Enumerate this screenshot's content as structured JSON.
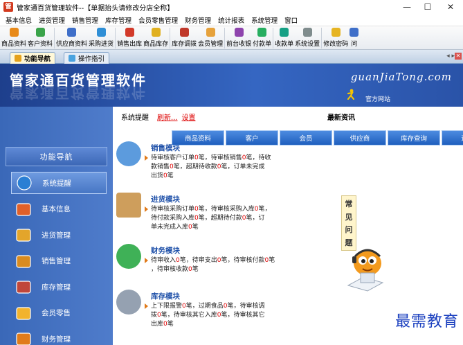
{
  "window": {
    "app_icon_char": "管",
    "title": "管家通百货管理软件--【单据抬头请修改分店全称】",
    "min_glyph": "—",
    "max_glyph": "☐",
    "close_glyph": "✕"
  },
  "menu": [
    "基本信息",
    "进货管理",
    "销售管理",
    "库存管理",
    "会员零售管理",
    "财务管理",
    "统计报表",
    "系统管理",
    "窗口"
  ],
  "toolbar": [
    {
      "label": "商品资料",
      "icon": "goods-icon",
      "color": "#e88a1a"
    },
    {
      "label": "客户资料",
      "icon": "customer-icon",
      "color": "#3aa34a"
    },
    {
      "label": "供应商资料",
      "icon": "supplier-icon",
      "color": "#3f6fc9"
    },
    {
      "label": "采购进货",
      "icon": "purchase-icon",
      "color": "#2f8fd6"
    },
    {
      "label": "销售出库",
      "icon": "sales-out-icon",
      "color": "#d23a2a"
    },
    {
      "label": "商品库存",
      "icon": "stock-icon",
      "color": "#e0b020"
    },
    {
      "label": "库存调拨",
      "icon": "transfer-icon",
      "color": "#c0392b"
    },
    {
      "label": "会员管理",
      "icon": "member-icon",
      "color": "#e6a23c"
    },
    {
      "label": "前台收银",
      "icon": "cashier-icon",
      "color": "#8e44ad"
    },
    {
      "label": "付款单",
      "icon": "payment-icon",
      "color": "#27ae60"
    },
    {
      "label": "收款单",
      "icon": "receipt-icon",
      "color": "#16a085"
    },
    {
      "label": "系统设置",
      "icon": "settings-icon",
      "color": "#7f8c8d"
    },
    {
      "label": "修改密码",
      "icon": "password-icon",
      "color": "#e6b422"
    },
    {
      "label": "问",
      "icon": "help-icon",
      "color": "#3f6fc9"
    }
  ],
  "tabs": [
    {
      "label": "功能导航"
    },
    {
      "label": "操作指引"
    }
  ],
  "tabnav": "◂ ▸",
  "tabclose": "✕",
  "banner": {
    "app_name": "管家通百货管理软件",
    "site": "guanJiaTong.com",
    "site_link": "官方网站"
  },
  "sidebar": {
    "header": "功能导航",
    "items": [
      {
        "label": "系统提醒",
        "icon": "info-icon",
        "active": true
      },
      {
        "label": "基本信息",
        "icon": "cubes-icon"
      },
      {
        "label": "进货管理",
        "icon": "purchase-box-icon"
      },
      {
        "label": "销售管理",
        "icon": "sales-box-icon"
      },
      {
        "label": "库存管理",
        "icon": "warehouse-icon"
      },
      {
        "label": "会员零售",
        "icon": "members-icon"
      },
      {
        "label": "财务管理",
        "icon": "finance-icon"
      }
    ]
  },
  "main": {
    "remind_label": "系统提醒",
    "refresh": "刷新...",
    "settings": "设置",
    "news_title": "最新资讯",
    "news_tabs": [
      "商品资料",
      "客户",
      "会员",
      "供应商",
      "库存查询",
      "退出"
    ],
    "modules": [
      {
        "title": "销售模块",
        "lines": [
          [
            {
              "t": "待审核客户订单"
            },
            {
              "n": "0"
            },
            {
              "t": "笔，待审核销售"
            },
            {
              "n": "0"
            },
            {
              "t": "笔，待收"
            }
          ],
          [
            {
              "t": "款销售"
            },
            {
              "n": "0"
            },
            {
              "t": "笔，超期待收款"
            },
            {
              "n": "0"
            },
            {
              "t": "笔，订单未完成"
            }
          ],
          [
            {
              "t": "出货"
            },
            {
              "n": "0"
            },
            {
              "t": "笔"
            }
          ]
        ]
      },
      {
        "title": "进货模块",
        "lines": [
          [
            {
              "t": "待审核采购订单"
            },
            {
              "n": "0"
            },
            {
              "t": "笔，待审核采购入库"
            },
            {
              "n": "0"
            },
            {
              "t": "笔，"
            }
          ],
          [
            {
              "t": "待付款采购入库"
            },
            {
              "n": "0"
            },
            {
              "t": "笔，超期待付款"
            },
            {
              "n": "0"
            },
            {
              "t": "笔，订"
            }
          ],
          [
            {
              "t": "单未完成入库"
            },
            {
              "n": "0"
            },
            {
              "t": "笔"
            }
          ]
        ]
      },
      {
        "title": "财务模块",
        "lines": [
          [
            {
              "t": "待审收入"
            },
            {
              "n": "0"
            },
            {
              "t": "笔，待审支出"
            },
            {
              "n": "0"
            },
            {
              "t": "笔，待审核付款"
            },
            {
              "n": "0"
            },
            {
              "t": "笔"
            }
          ],
          [
            {
              "t": "，待审核收款"
            },
            {
              "n": "0"
            },
            {
              "t": "笔"
            }
          ]
        ]
      },
      {
        "title": "库存模块",
        "lines": [
          [
            {
              "t": "上下限报警"
            },
            {
              "n": "0"
            },
            {
              "t": "笔，过期食品"
            },
            {
              "n": "0"
            },
            {
              "t": "笔，待审核调"
            }
          ],
          [
            {
              "t": "拨"
            },
            {
              "n": "0"
            },
            {
              "t": "笔，待审核其它入库"
            },
            {
              "n": "0"
            },
            {
              "t": "笔，待审核其它"
            }
          ],
          [
            {
              "t": "出库"
            },
            {
              "n": "0"
            },
            {
              "t": "笔"
            }
          ]
        ]
      }
    ],
    "faq": [
      "常",
      "见",
      "问",
      "题"
    ]
  },
  "watermark": "最需教育"
}
